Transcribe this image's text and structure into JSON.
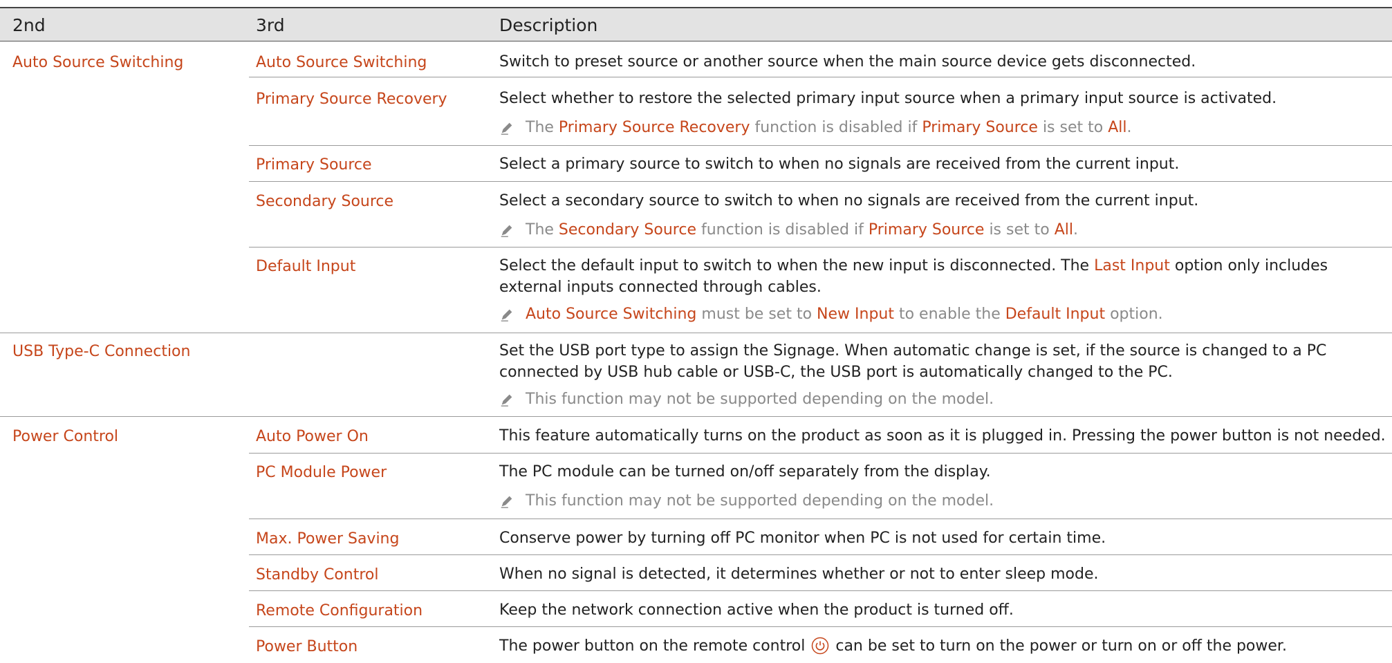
{
  "header": {
    "col2": "2nd",
    "col3": "3rd",
    "col4": "Description"
  },
  "rows": [
    {
      "c2": "Auto Source Switching",
      "c3": "Auto Source Switching",
      "desc": "Switch to preset source or another source when the main source device gets disconnected."
    },
    {
      "c3": "Primary Source Recovery",
      "desc": "Select whether to restore the selected primary input source when a primary input source is activated.",
      "note": {
        "a": "The ",
        "b": "Primary Source Recovery",
        "c": " function is disabled if ",
        "d": "Primary Source",
        "e": " is set to ",
        "f": "All",
        "g": "."
      }
    },
    {
      "c3": "Primary Source",
      "desc": "Select a primary source to switch to when no signals are received from the current input."
    },
    {
      "c3": "Secondary Source",
      "desc": "Select a secondary source to switch to when no signals are received from the current input.",
      "note": {
        "a": "The ",
        "b": "Secondary Source",
        "c": " function is disabled if ",
        "d": "Primary Source",
        "e": " is set to ",
        "f": "All",
        "g": "."
      }
    },
    {
      "c3": "Default Input",
      "desc_a": "Select the default input to switch to when the new input is disconnected. The ",
      "desc_b": "Last Input",
      "desc_c": " option only includes external inputs connected through cables.",
      "note": {
        "a": "Auto Source Switching",
        "b": " must be set to ",
        "c": "New Input",
        "d": " to enable the ",
        "e": "Default Input",
        "f": " option."
      }
    },
    {
      "c2": "USB Type-C Connection",
      "desc": "Set the USB port type to assign the Signage. When automatic change is set, if the source is changed to a PC connected by USB hub cable or USB-C, the USB port is automatically changed to the PC.",
      "note": {
        "a": "This function may not be supported depending on the model."
      }
    },
    {
      "c2": "Power Control",
      "c3": "Auto Power On",
      "desc": "This feature automatically turns on the product as soon as it is plugged in. Pressing the power button is not needed."
    },
    {
      "c3": "PC Module Power",
      "desc": "The PC module can be turned on/off separately from the display.",
      "note": {
        "a": "This function may not be supported depending on the model."
      }
    },
    {
      "c3": "Max. Power Saving",
      "desc": "Conserve power by turning off PC monitor when PC is not used for certain time."
    },
    {
      "c3": "Standby Control",
      "desc": "When no signal is detected, it determines whether or not to enter sleep mode."
    },
    {
      "c3": "Remote Configuration",
      "desc": "Keep the network connection active when the product is turned off."
    },
    {
      "c3": "Power Button",
      "desc_a": "The power button on the remote control ",
      "desc_b": " can be set to turn on the power or turn on or off the power."
    }
  ],
  "icons": {
    "note": "pencil-icon",
    "power": "power-icon"
  },
  "colors": {
    "accent": "#c6461b",
    "header_bg": "#e3e3e3",
    "note_text": "#8a8a8a"
  }
}
